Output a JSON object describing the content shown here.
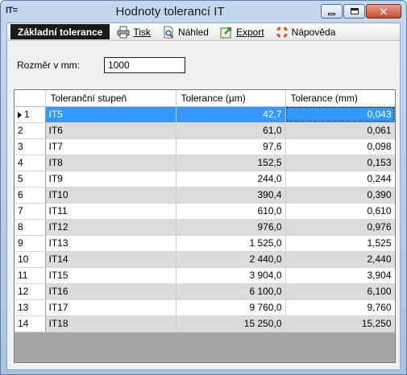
{
  "window": {
    "icon_text": "IT=",
    "title": "Hodnoty tolerancí IT"
  },
  "menu": {
    "items": [
      {
        "label": "Základní tolerance",
        "icon": "none"
      },
      {
        "label": "Tisk",
        "icon": "printer-icon"
      },
      {
        "label": "Náhled",
        "icon": "print-preview-icon"
      },
      {
        "label": "Export",
        "icon": "export-icon"
      },
      {
        "label": "Nápověda",
        "icon": "help-lifebuoy-icon"
      }
    ]
  },
  "form": {
    "size_label": "Rozměr v mm:",
    "size_value": "1000"
  },
  "table": {
    "columns": [
      "Toleranční stupeň",
      "Tolerance (µm)",
      "Tolerance (mm)"
    ],
    "selected_row": 0,
    "rows": [
      {
        "n": "1",
        "grade": "IT5",
        "um": "42,7",
        "mm": "0,043"
      },
      {
        "n": "2",
        "grade": "IT6",
        "um": "61,0",
        "mm": "0,061"
      },
      {
        "n": "3",
        "grade": "IT7",
        "um": "97,6",
        "mm": "0,098"
      },
      {
        "n": "4",
        "grade": "IT8",
        "um": "152,5",
        "mm": "0,153"
      },
      {
        "n": "5",
        "grade": "IT9",
        "um": "244,0",
        "mm": "0,244"
      },
      {
        "n": "6",
        "grade": "IT10",
        "um": "390,4",
        "mm": "0,390"
      },
      {
        "n": "7",
        "grade": "IT11",
        "um": "610,0",
        "mm": "0,610"
      },
      {
        "n": "8",
        "grade": "IT12",
        "um": "976,0",
        "mm": "0,976"
      },
      {
        "n": "9",
        "grade": "IT13",
        "um": "1 525,0",
        "mm": "1,525"
      },
      {
        "n": "10",
        "grade": "IT14",
        "um": "2 440,0",
        "mm": "2,440"
      },
      {
        "n": "11",
        "grade": "IT15",
        "um": "3 904,0",
        "mm": "3,904"
      },
      {
        "n": "12",
        "grade": "IT16",
        "um": "6 100,0",
        "mm": "6,100"
      },
      {
        "n": "13",
        "grade": "IT17",
        "um": "9 760,0",
        "mm": "9,760"
      },
      {
        "n": "14",
        "grade": "IT18",
        "um": "15 250,0",
        "mm": "15,250"
      }
    ]
  }
}
